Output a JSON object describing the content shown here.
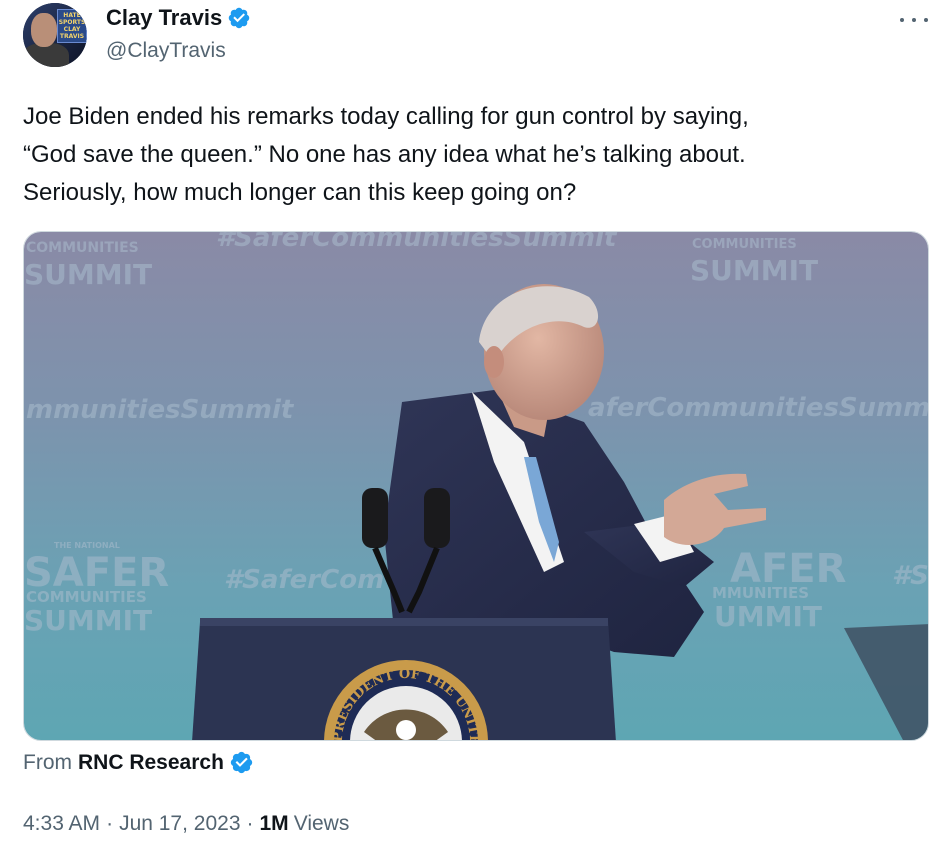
{
  "author": {
    "display_name": "Clay Travis",
    "handle": "@ClayTravis",
    "avatar_sign_text": "HATE SPORTS CLAY TRAVIS"
  },
  "tweet": {
    "text": "Joe Biden ended his remarks today calling for gun control by saying,\n“God save the queen.” No one has any idea what he’s talking about.\nSeriously, how much longer can this keep going on?"
  },
  "media": {
    "backdrop_texts": {
      "summit_top_left": [
        "COMMUNITIES",
        "SUMMIT"
      ],
      "hashtag_top": "#SaferCommunitiesSummit",
      "summit_top_right": [
        "COMMUNITIES",
        "SUMMIT"
      ],
      "hashtag_mid_left": "mmunitiesSummit",
      "hashtag_mid_right": "aferCommunitiesSumm",
      "safer_left": [
        "THE NATIONAL",
        "SAFER",
        "COMMUNITIES",
        "SUMMIT"
      ],
      "hashtag_low": "#SaferCom",
      "safer_right": [
        "AFER",
        "MMUNITIES",
        "UMMIT"
      ],
      "hashtag_right_edge": "#S",
      "seal_text": "PRESIDENT OF THE UNITED"
    }
  },
  "source": {
    "from_label": "From",
    "name": "RNC Research"
  },
  "meta": {
    "time": "4:33 AM",
    "date": "Jun 17, 2023",
    "separator": "·",
    "views_count": "1M",
    "views_label": "Views"
  },
  "colors": {
    "verified": "#1d9bf0",
    "secondary_text": "#536471",
    "primary_text": "#0f1419"
  }
}
